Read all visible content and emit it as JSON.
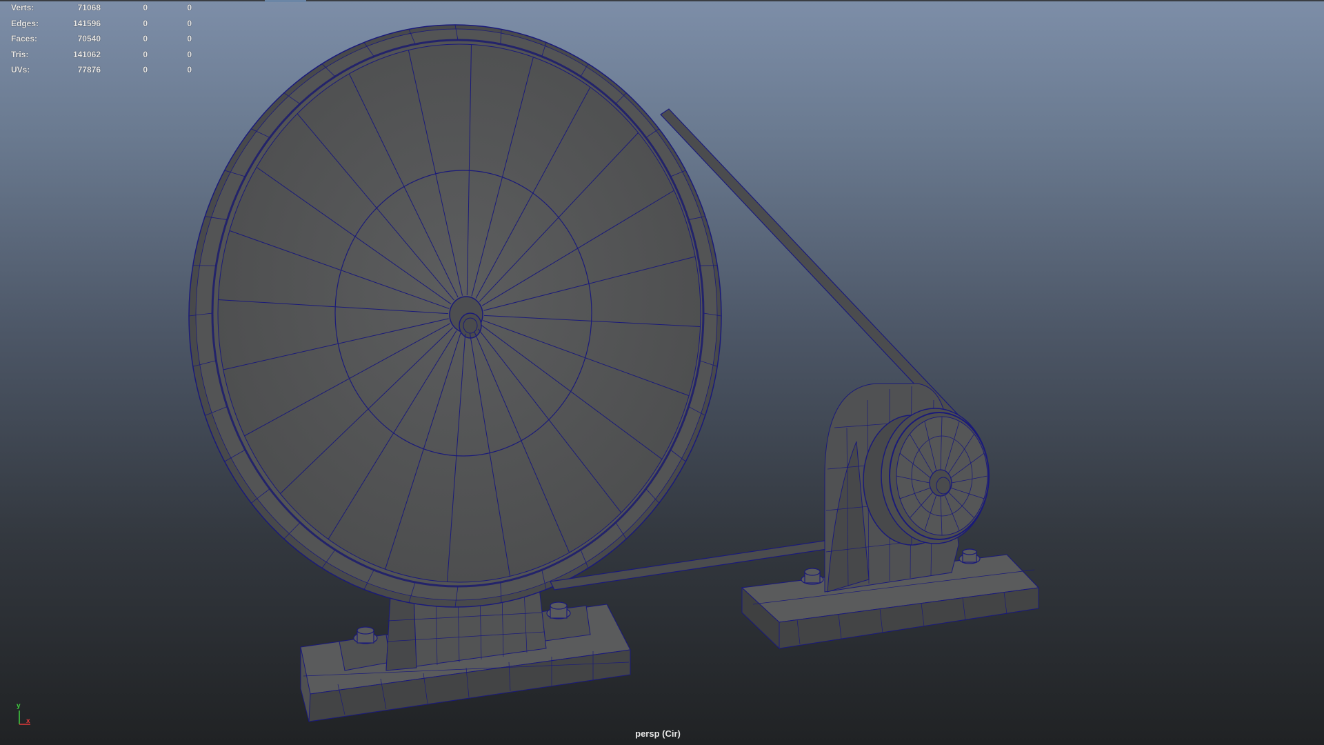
{
  "hud": {
    "rows": [
      {
        "label": "Verts:",
        "v1": "71068",
        "v2": "0",
        "v3": "0"
      },
      {
        "label": "Edges:",
        "v1": "141596",
        "v2": "0",
        "v3": "0"
      },
      {
        "label": "Faces:",
        "v1": "70540",
        "v2": "0",
        "v3": "0"
      },
      {
        "label": "Tris:",
        "v1": "141062",
        "v2": "0",
        "v3": "0"
      },
      {
        "label": "UVs:",
        "v1": "77876",
        "v2": "0",
        "v3": "0"
      }
    ]
  },
  "camera": {
    "label": "persp (Cir)"
  },
  "axis_gizmo": {
    "y_label": "y",
    "x_label": "x",
    "y_color": "#3fd13f",
    "x_color": "#e23a3a"
  },
  "colors": {
    "wire": "#1a1a7a",
    "surface": "#565758",
    "surface_dark": "#444546"
  },
  "icons": [
    "axis-gizmo-icon"
  ]
}
